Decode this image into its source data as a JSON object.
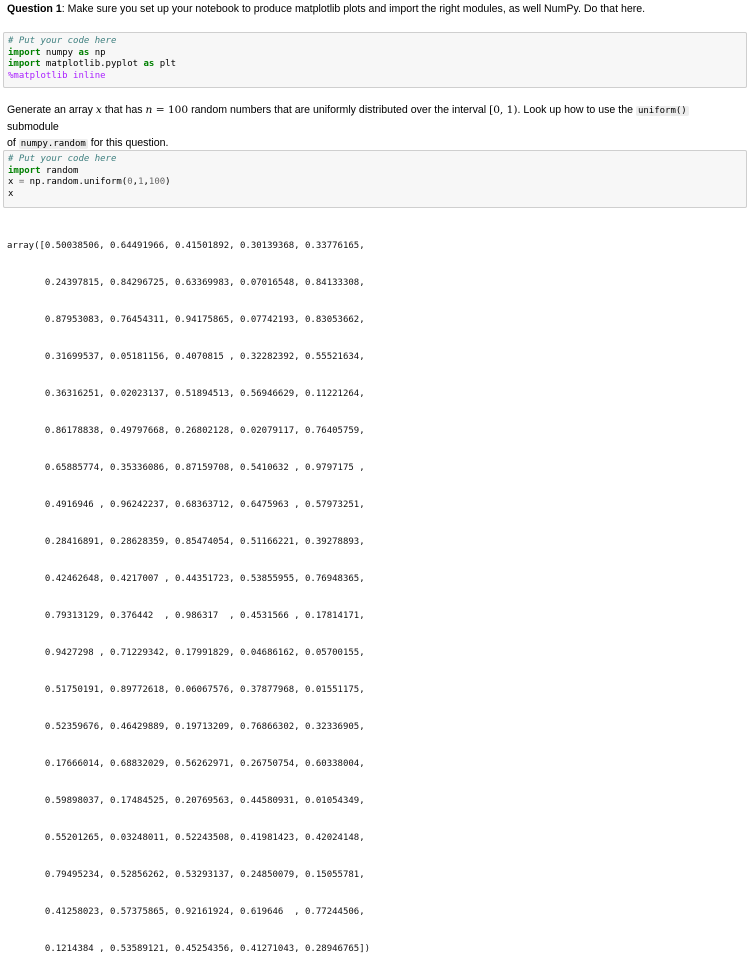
{
  "question": {
    "label": "Question 1",
    "text": ": Make sure you set up your notebook to produce matplotlib plots and import the right modules, as well NumPy. Do that here."
  },
  "cell1": {
    "comment": "# Put your code here",
    "kw_import1": "import",
    "mod1": " numpy ",
    "kw_as": "as",
    "alias1": " np",
    "kw_import2": "import",
    "mod2": " matplotlib.pyplot ",
    "kw_as2": "as",
    "alias2": " plt",
    "magic": "%matplotlib inline"
  },
  "instruction": {
    "part1": "Generate an array ",
    "var_x": "x",
    "part2": " that has ",
    "var_n": "n",
    "eq": " = 100",
    "part3": " random numbers that are uniformly distributed over the interval ",
    "interval": "[0, 1)",
    "part4": ". Look up how to use the ",
    "code_uniform": "uniform()",
    "part5": " submodule",
    "part6": "of ",
    "code_numpy_random": "numpy.random",
    "part7": " for this question."
  },
  "cell2": {
    "comment": "# Put your code here",
    "kw_import": "import",
    "mod": " random",
    "assign_lhs": "x ",
    "assign_eq": "=",
    "assign_rhs": " np.random.uniform(",
    "arg0": "0",
    "comma1": ",",
    "arg1": "1",
    "comma2": ",",
    "arg2": "100",
    "close": ")",
    "echo": "x"
  },
  "output_lines": [
    "array([0.50038506, 0.64491966, 0.41501892, 0.30139368, 0.33776165,",
    "       0.24397815, 0.84296725, 0.63369983, 0.07016548, 0.84133308,",
    "       0.87953083, 0.76454311, 0.94175865, 0.07742193, 0.83053662,",
    "       0.31699537, 0.05181156, 0.4070815 , 0.32282392, 0.55521634,",
    "       0.36316251, 0.02023137, 0.51894513, 0.56946629, 0.11221264,",
    "       0.86178838, 0.49797668, 0.26802128, 0.02079117, 0.76405759,",
    "       0.65885774, 0.35336086, 0.87159708, 0.5410632 , 0.9797175 ,",
    "       0.4916946 , 0.96242237, 0.68363712, 0.6475963 , 0.57973251,",
    "       0.28416891, 0.28628359, 0.85474054, 0.51166221, 0.39278893,",
    "       0.42462648, 0.4217007 , 0.44351723, 0.53855955, 0.76948365,",
    "       0.79313129, 0.376442  , 0.986317  , 0.4531566 , 0.17814171,",
    "       0.9427298 , 0.71229342, 0.17991829, 0.04686162, 0.05700155,",
    "       0.51750191, 0.89772618, 0.06067576, 0.37877968, 0.01551175,",
    "       0.52359676, 0.46429889, 0.19713209, 0.76866302, 0.32336905,",
    "       0.17666014, 0.68832029, 0.56262971, 0.26750754, 0.60338004,",
    "       0.59898037, 0.17484525, 0.20769563, 0.44580931, 0.01054349,",
    "       0.55201265, 0.03248011, 0.52243508, 0.41981423, 0.42024148,",
    "       0.79495234, 0.52856262, 0.53293137, 0.24850079, 0.15055781,",
    "       0.41258023, 0.57375865, 0.92161924, 0.619646  , 0.77244506,",
    "       0.1214384 , 0.53589121, 0.45254356, 0.41271043, 0.28946765])"
  ]
}
